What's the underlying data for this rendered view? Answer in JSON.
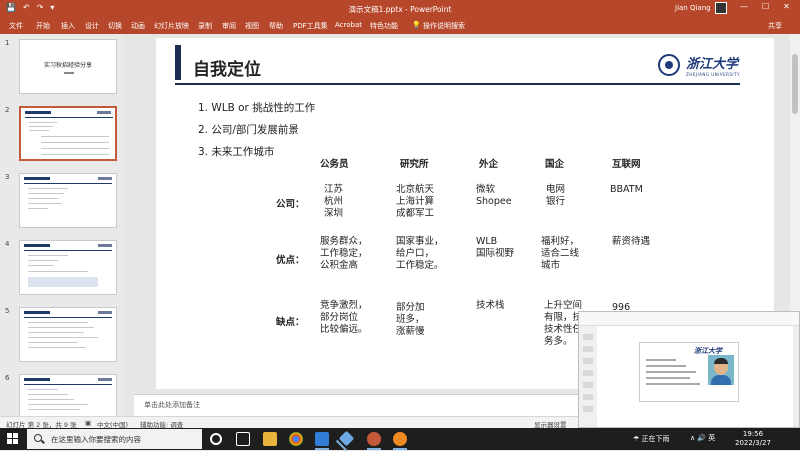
{
  "window": {
    "title": "演示文稿1.pptx  -  PowerPoint",
    "user": "Jian Qiang",
    "quick_access": [
      "💾",
      "↶",
      "↷",
      "▾"
    ],
    "buttons": [
      "—",
      "☐",
      "✕"
    ]
  },
  "ribbon": {
    "tabs": [
      "文件",
      "开始",
      "插入",
      "设计",
      "切换",
      "动画",
      "幻灯片放映",
      "录制",
      "审阅",
      "视图",
      "帮助",
      "PDF工具集",
      "Acrobat",
      "特色功能",
      "操作说明搜索"
    ],
    "share": "共享"
  },
  "thumbnails": [
    {
      "num": "1",
      "text": "实习秋招经验分享"
    },
    {
      "num": "2",
      "text": ""
    },
    {
      "num": "3",
      "text": ""
    },
    {
      "num": "4",
      "text": ""
    },
    {
      "num": "5",
      "text": ""
    },
    {
      "num": "6",
      "text": ""
    }
  ],
  "slide": {
    "title": "自我定位",
    "logo_cn": "浙江大学",
    "logo_en": "ZHEJIANG UNIVERSITY",
    "bullets": [
      "1. WLB or 挑战性的工作",
      "2. 公司/部门发展前景",
      "3. 未来工作城市"
    ],
    "columns": [
      "公务员",
      "研究所",
      "外企",
      "国企",
      "互联网"
    ],
    "rows": [
      {
        "label": "公司：",
        "cells": [
          [
            "江苏",
            "杭州",
            "深圳"
          ],
          [
            "北京航天",
            "上海计算",
            "成都军工"
          ],
          [
            "微软",
            "Shopee"
          ],
          [
            "电网",
            "银行"
          ],
          [
            "BBATM"
          ]
        ]
      },
      {
        "label": "优点：",
        "cells": [
          [
            "服务群众，",
            "工作稳定，",
            "公积金高"
          ],
          [
            "国家事业，",
            "给户口，",
            "工作稳定。"
          ],
          [
            "WLB",
            "国际视野"
          ],
          [
            "福利好，",
            "适合二线",
            "城市"
          ],
          [
            "薪资待遇"
          ]
        ]
      },
      {
        "label": "缺点：",
        "cells": [
          [
            "竞争激烈，",
            "部分岗位",
            "比较偏远。"
          ],
          [
            "部分加",
            "班多，",
            "涨薪慢"
          ],
          [
            "技术栈"
          ],
          [
            "上升空间",
            "有限，技",
            "技术性任",
            "务多。"
          ],
          [
            "996"
          ]
        ]
      }
    ]
  },
  "notes": {
    "placeholder": "单击此处添加备注"
  },
  "status": {
    "slide_info": "幻灯片 第 2 张，共 9 张",
    "language": "中文(中国)",
    "accessibility": "辅助功能: 调查",
    "display": "显示器设置"
  },
  "taskbar": {
    "search_placeholder": "在这里输入你要搜索的内容",
    "weather": "正在下雨",
    "time": "19:56",
    "date": "2022/3/27",
    "tray": "∧ 🔊 英"
  }
}
